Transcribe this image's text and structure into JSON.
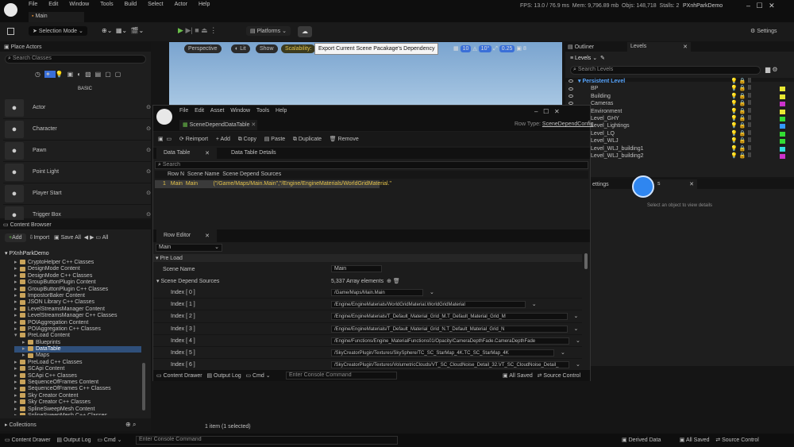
{
  "menu": {
    "items": [
      "File",
      "Edit",
      "Window",
      "Tools",
      "Build",
      "Select",
      "Actor",
      "Help"
    ],
    "tab": "Main",
    "stats": {
      "fps": "FPS: 13.0",
      "ms": "/ 76.9 ms",
      "mem": "Mem: 9,796.89 mb",
      "objs": "Objs: 148,718",
      "stalls": "Stalls: 2"
    },
    "project": "PXnhParkDemo"
  },
  "toolbar": {
    "mode": "Selection Mode",
    "platforms": "Platforms",
    "settings": "Settings"
  },
  "place_actors": {
    "title": "Place Actors",
    "search": "Search Classes",
    "section": "BASIC",
    "items": [
      "Actor",
      "Character",
      "Pawn",
      "Point Light",
      "Player Start",
      "Trigger Box"
    ]
  },
  "viewport": {
    "perspective": "Perspective",
    "lit": "Lit",
    "show": "Show",
    "scalability": "Scalability:",
    "tooltip": "Export Current Scene Pacakage's Dependency",
    "grid": "10",
    "angle": "10°",
    "scale": "0.25",
    "cam": "8"
  },
  "outliner": {
    "tab1": "Outliner",
    "tab2": "Levels",
    "levels_btn": "Levels",
    "search": "Search Levels",
    "persistent": "Persistent Level",
    "levels": [
      "BP",
      "Building",
      "Cameras",
      "Environment",
      "Level_GHY",
      "Level_Lightings",
      "Level_LQ",
      "Level_WLJ",
      "Level_WLJ_building1",
      "Level_WLJ_building2"
    ],
    "colors": [
      "#e8e833",
      "#e8e833",
      "#cc33cc",
      "#e8e833",
      "#33dd33",
      "#3399ff",
      "#33dd33",
      "#33dd33",
      "#33dddd",
      "#cc33cc"
    ]
  },
  "details": {
    "tab": "ettings",
    "tab2": "s",
    "empty": "Select an object to view details"
  },
  "content_browser": {
    "title": "Content Browser",
    "add": "Add",
    "import": "Import",
    "save_all": "Save All",
    "all": "All",
    "root": "PXnhParkDemo",
    "tree": [
      "CryptoHelper C++ Classes",
      "DesignMode Content",
      "DesignMode C++ Classes",
      "GroupButtonPlugin Content",
      "GroupButtonPlugin C++ Classes",
      "ImpostorBaker Content",
      "JSON Library C++ Classes",
      "LevelStreamsManager Content",
      "LevelStreamsManager C++ Classes",
      "POIAggregation Content",
      "POIAggregation C++ Classes",
      "PreLoad Content",
      "Blueprints",
      "DataTable",
      "Maps",
      "PreLoad C++ Classes",
      "SCApi Content",
      "SCApi C++ Classes",
      "SequenceOfFrames Content",
      "SequenceOfFrames C++ Classes",
      "Sky Creator Content",
      "Sky Creator C++ Classes",
      "SplineSweepMesh Content",
      "SplineSweepMesh C++ Classes"
    ],
    "collections": "Collections",
    "count": "1 item (1 selected)"
  },
  "dt": {
    "menu": [
      "File",
      "Edit",
      "Asset",
      "Window",
      "Tools",
      "Help"
    ],
    "title": "SceneDependDataTable",
    "row_type_label": "Row Type:",
    "row_type": "SceneDependConfig",
    "reimport": "Reimport",
    "add": "Add",
    "copy": "Copy",
    "paste": "Paste",
    "duplicate": "Duplicate",
    "remove": "Remove",
    "tab1": "Data Table",
    "tab2": "Data Table Details",
    "search": "Search",
    "cols": [
      "Row N",
      "Scene Name",
      "Scene Depend Sources"
    ],
    "row": {
      "num": "1",
      "key": "Main",
      "name": "Main",
      "src": "(\"/Game/Maps/Main.Main\",\"/Engine/EngineMaterials/WorldGridMaterial.\""
    },
    "row_editor": "Row Editor",
    "row_select": "Main",
    "preload": "Pre Load",
    "scene_name_label": "Scene Name",
    "scene_name": "Main",
    "sources_label": "Scene Depend Sources",
    "elements": "5,337 Array elements",
    "indices": [
      {
        "l": "Index [ 0 ]",
        "v": "/Game/Maps/Main.Main"
      },
      {
        "l": "Index [ 1 ]",
        "v": "/Engine/EngineMaterials/WorldGridMaterial.WorldGridMaterial"
      },
      {
        "l": "Index [ 2 ]",
        "v": "/Engine/EngineMaterials/T_Default_Material_Grid_M.T_Default_Material_Grid_M"
      },
      {
        "l": "Index [ 3 ]",
        "v": "/Engine/EngineMaterials/T_Default_Material_Grid_N.T_Default_Material_Grid_N"
      },
      {
        "l": "Index [ 4 ]",
        "v": "/Engine/Functions/Engine_MaterialFunctions01/Opacity/CameraDepthFade.CameraDepthFade"
      },
      {
        "l": "Index [ 5 ]",
        "v": "/SkyCreatorPlugin/Textures/SkySphere/TC_SC_StarMap_4K.TC_SC_StarMap_4K"
      },
      {
        "l": "Index [ 6 ]",
        "v": "/SkyCreatorPlugin/Textures/VolumetricClouds/VT_SC_CloudNoise_Detail_32.VT_SC_CloudNoise_Detail_"
      }
    ],
    "content_drawer": "Content Drawer",
    "output_log": "Output Log",
    "cmd": "Cmd",
    "console": "Enter Console Command",
    "all_saved": "All Saved",
    "source_control": "Source Control"
  },
  "status": {
    "content_drawer": "Content Drawer",
    "output_log": "Output Log",
    "cmd": "Cmd",
    "console": "Enter Console Command",
    "derived": "Derived Data",
    "all_saved": "All Saved",
    "source_control": "Source Control"
  }
}
